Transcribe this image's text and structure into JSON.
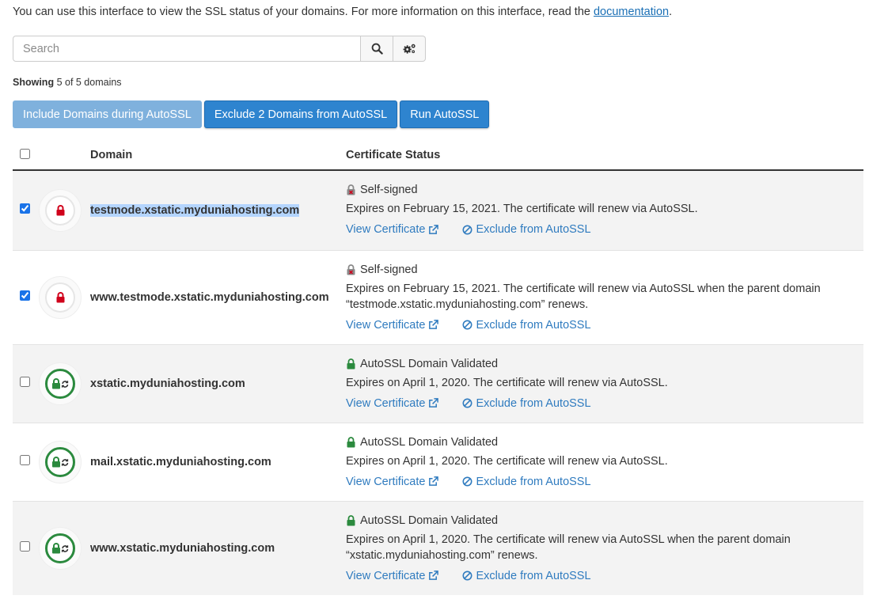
{
  "intro": {
    "text": "You can use this interface to view the SSL status of your domains. For more information on this interface, read the ",
    "link": "documentation",
    "end": "."
  },
  "search": {
    "placeholder": "Search",
    "value": ""
  },
  "showing": {
    "label": "Showing",
    "text": "5 of 5 domains"
  },
  "buttons": {
    "include": "Include Domains during AutoSSL",
    "exclude": "Exclude 2 Domains from AutoSSL",
    "run": "Run AutoSSL"
  },
  "table": {
    "headers": {
      "domain": "Domain",
      "status": "Certificate Status"
    },
    "rows": [
      {
        "domain": "testmode.xstatic.myduniahosting.com",
        "status": "Self-signed",
        "expires": "Expires on February 15, 2021. The certificate will renew via AutoSSL.",
        "view": "View Certificate",
        "exclude": "Exclude from AutoSSL"
      },
      {
        "domain": "www.testmode.xstatic.myduniahosting.com",
        "status": "Self-signed",
        "expires": "Expires on February 15, 2021. The certificate will renew via AutoSSL when the parent domain “testmode.xstatic.myduniahosting.com” renews.",
        "view": "View Certificate",
        "exclude": "Exclude from AutoSSL"
      },
      {
        "domain": "xstatic.myduniahosting.com",
        "status": "AutoSSL Domain Validated",
        "expires": "Expires on April 1, 2020. The certificate will renew via AutoSSL.",
        "view": "View Certificate",
        "exclude": "Exclude from AutoSSL"
      },
      {
        "domain": "mail.xstatic.myduniahosting.com",
        "status": "AutoSSL Domain Validated",
        "expires": "Expires on April 1, 2020. The certificate will renew via AutoSSL.",
        "view": "View Certificate",
        "exclude": "Exclude from AutoSSL"
      },
      {
        "domain": "www.xstatic.myduniahosting.com",
        "status": "AutoSSL Domain Validated",
        "expires": "Expires on April 1, 2020. The certificate will renew via AutoSSL when the parent domain “xstatic.myduniahosting.com” renews.",
        "view": "View Certificate",
        "exclude": "Exclude from AutoSSL"
      }
    ]
  },
  "colors": {
    "link": "#2f7bbf",
    "danger": "#d0021b",
    "success": "#2b8a3e",
    "primary": "#2e84cf"
  }
}
